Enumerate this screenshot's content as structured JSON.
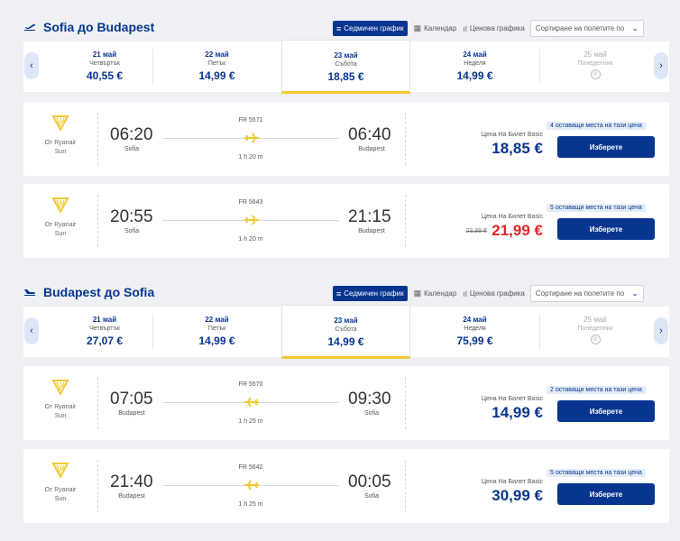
{
  "controls": {
    "weekly_label": "Седмичен график",
    "calendar_label": "Календар",
    "price_chart_label": "Ценова графика",
    "sort_placeholder": "Сортиране на полетите по"
  },
  "outbound": {
    "title": "Sofia до Budapest",
    "dates": [
      {
        "date": "21 май",
        "weekday": "Четвъртък",
        "price": "40,55 €"
      },
      {
        "date": "22 май",
        "weekday": "Петък",
        "price": "14,99 €"
      },
      {
        "date": "23 май",
        "weekday": "Събота",
        "price": "18,85 €"
      },
      {
        "date": "24 май",
        "weekday": "Неделя",
        "price": "14,99 €"
      },
      {
        "date": "25 май",
        "weekday": "Понеделник"
      }
    ],
    "flights": [
      {
        "operator": "От Ryanair",
        "operator2": "Sun",
        "dep_time": "06:20",
        "dep_city": "Sofia",
        "arr_time": "06:40",
        "arr_city": "Budapest",
        "flight_no": "FR 5571",
        "duration": "1 h 20 m",
        "price_label": "Цена На Билет Basic",
        "price": "18,85 €",
        "seats": "4 оставащи места на тази цена",
        "select_label": "Изберете"
      },
      {
        "operator": "От Ryanair",
        "operator2": "Sun",
        "dep_time": "20:55",
        "dep_city": "Sofia",
        "arr_time": "21:15",
        "arr_city": "Budapest",
        "flight_no": "FR 5643",
        "duration": "1 h 20 m",
        "price_label": "Цена На Билет Basic",
        "old_price": "23,99 €",
        "price": "21,99 €",
        "seats": "5 оставащи места на тази цена",
        "select_label": "Изберете"
      }
    ]
  },
  "inbound": {
    "title": "Budapest до Sofia",
    "dates": [
      {
        "date": "21 май",
        "weekday": "Четвъртък",
        "price": "27,07 €"
      },
      {
        "date": "22 май",
        "weekday": "Петък",
        "price": "14,99 €"
      },
      {
        "date": "23 май",
        "weekday": "Събота",
        "price": "14,99 €"
      },
      {
        "date": "24 май",
        "weekday": "Неделя",
        "price": "75,99 €"
      },
      {
        "date": "25 май",
        "weekday": "Понеделник"
      }
    ],
    "flights": [
      {
        "operator": "От Ryanair",
        "operator2": "Sun",
        "dep_time": "07:05",
        "dep_city": "Budapest",
        "arr_time": "09:30",
        "arr_city": "Sofia",
        "flight_no": "FR 5570",
        "duration": "1 h 25 m",
        "price_label": "Цена На Билет Basic",
        "price": "14,99 €",
        "seats": "2 оставащи места на тази цена",
        "select_label": "Изберете"
      },
      {
        "operator": "От Ryanair",
        "operator2": "Sun",
        "dep_time": "21:40",
        "dep_city": "Budapest",
        "arr_time": "00:05",
        "arr_city": "Sofia",
        "flight_no": "FR 5642",
        "duration": "1 h 25 m",
        "price_label": "Цена На Билет Basic",
        "price": "30,99 €",
        "seats": "5 оставащи места на тази цена",
        "select_label": "Изберете"
      }
    ]
  },
  "colors": {
    "brand": "#073590",
    "accent": "#f1c933",
    "sale": "#e0262a"
  }
}
